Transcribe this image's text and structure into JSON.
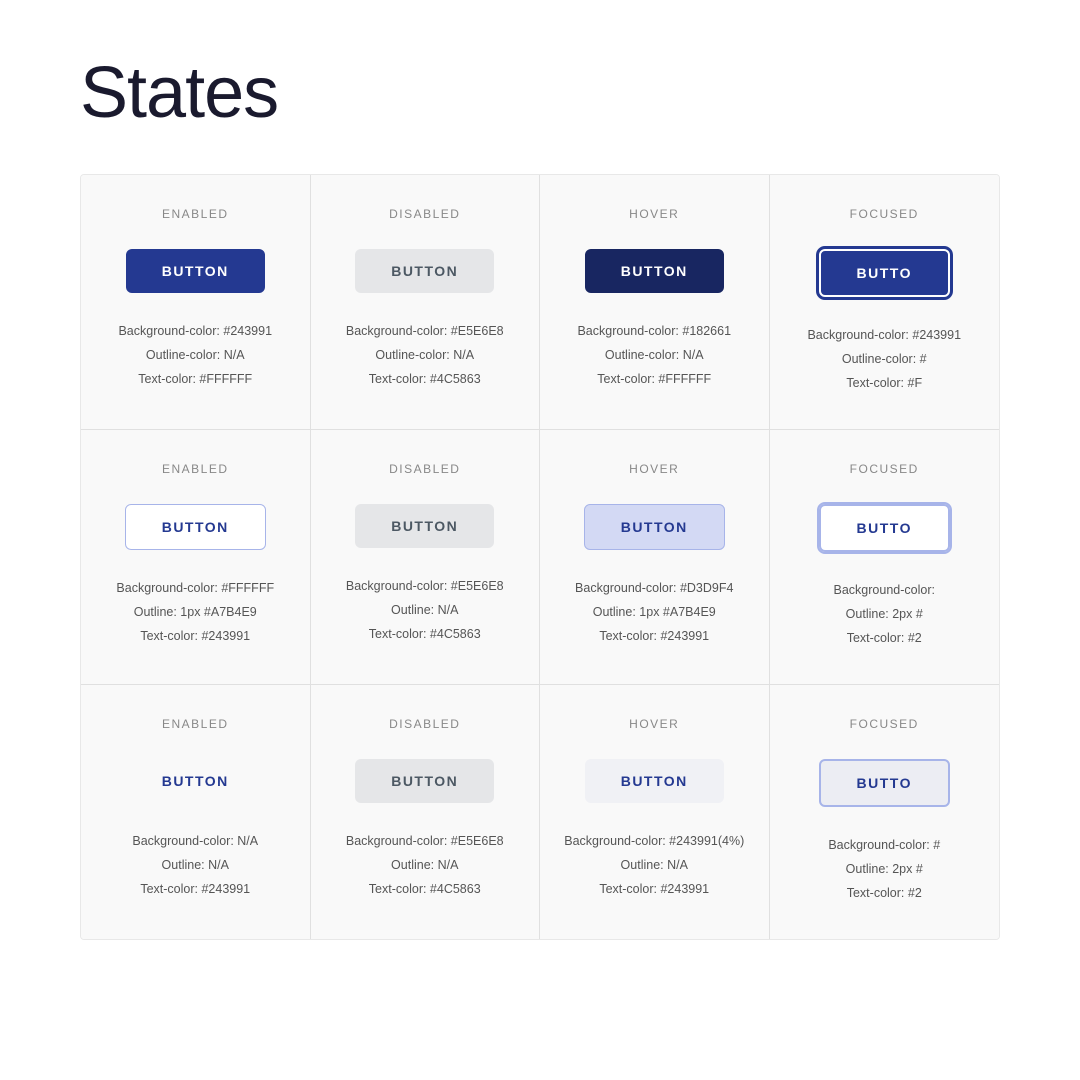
{
  "page": {
    "title": "States"
  },
  "rows": [
    {
      "id": "row-solid",
      "cells": [
        {
          "state": "ENABLED",
          "btnClass": "btn-solid-enabled",
          "btnLabel": "BUTTON",
          "info": [
            "Background-color: #243991",
            "Outline-color: N/A",
            "Text-color: #FFFFFF"
          ]
        },
        {
          "state": "DISABLED",
          "btnClass": "btn-solid-disabled",
          "btnLabel": "BUTTON",
          "info": [
            "Background-color: #E5E6E8",
            "Outline-color: N/A",
            "Text-color: #4C5863"
          ]
        },
        {
          "state": "HOVER",
          "btnClass": "btn-solid-hover",
          "btnLabel": "BUTTON",
          "info": [
            "Background-color: #182661",
            "Outline-color: N/A",
            "Text-color: #FFFFFF"
          ]
        },
        {
          "state": "FOCUSED",
          "btnClass": "btn-solid-focused",
          "btnLabel": "BUTTO",
          "info": [
            "Background-color: #243991",
            "Outline-color: #",
            "Text-color: #F"
          ]
        }
      ]
    },
    {
      "id": "row-outline",
      "cells": [
        {
          "state": "ENABLED",
          "btnClass": "btn-outline-enabled",
          "btnLabel": "BUTTON",
          "info": [
            "Background-color: #FFFFFF",
            "Outline: 1px #A7B4E9",
            "Text-color: #243991"
          ]
        },
        {
          "state": "DISABLED",
          "btnClass": "btn-outline-disabled",
          "btnLabel": "BUTTON",
          "info": [
            "Background-color: #E5E6E8",
            "Outline: N/A",
            "Text-color: #4C5863"
          ]
        },
        {
          "state": "HOVER",
          "btnClass": "btn-outline-hover",
          "btnLabel": "BUTTON",
          "info": [
            "Background-color: #D3D9F4",
            "Outline: 1px #A7B4E9",
            "Text-color: #243991"
          ]
        },
        {
          "state": "FOCUSED",
          "btnClass": "btn-outline-focused",
          "btnLabel": "BUTTO",
          "info": [
            "Background-color:",
            "Outline: 2px #",
            "Text-color: #2"
          ]
        }
      ]
    },
    {
      "id": "row-ghost",
      "cells": [
        {
          "state": "ENABLED",
          "btnClass": "btn-ghost-enabled",
          "btnLabel": "BUTTON",
          "info": [
            "Background-color: N/A",
            "Outline: N/A",
            "Text-color: #243991"
          ]
        },
        {
          "state": "DISABLED",
          "btnClass": "btn-ghost-disabled",
          "btnLabel": "BUTTON",
          "info": [
            "Background-color: #E5E6E8",
            "Outline: N/A",
            "Text-color: #4C5863"
          ]
        },
        {
          "state": "HOVER",
          "btnClass": "btn-ghost-hover",
          "btnLabel": "BUTTON",
          "info": [
            "Background-color: #243991(4%)",
            "Outline: N/A",
            "Text-color: #243991"
          ]
        },
        {
          "state": "FOCUSED",
          "btnClass": "btn-ghost-focused",
          "btnLabel": "BUTTO",
          "info": [
            "Background-color: #",
            "Outline: 2px #",
            "Text-color: #2"
          ]
        }
      ]
    }
  ]
}
